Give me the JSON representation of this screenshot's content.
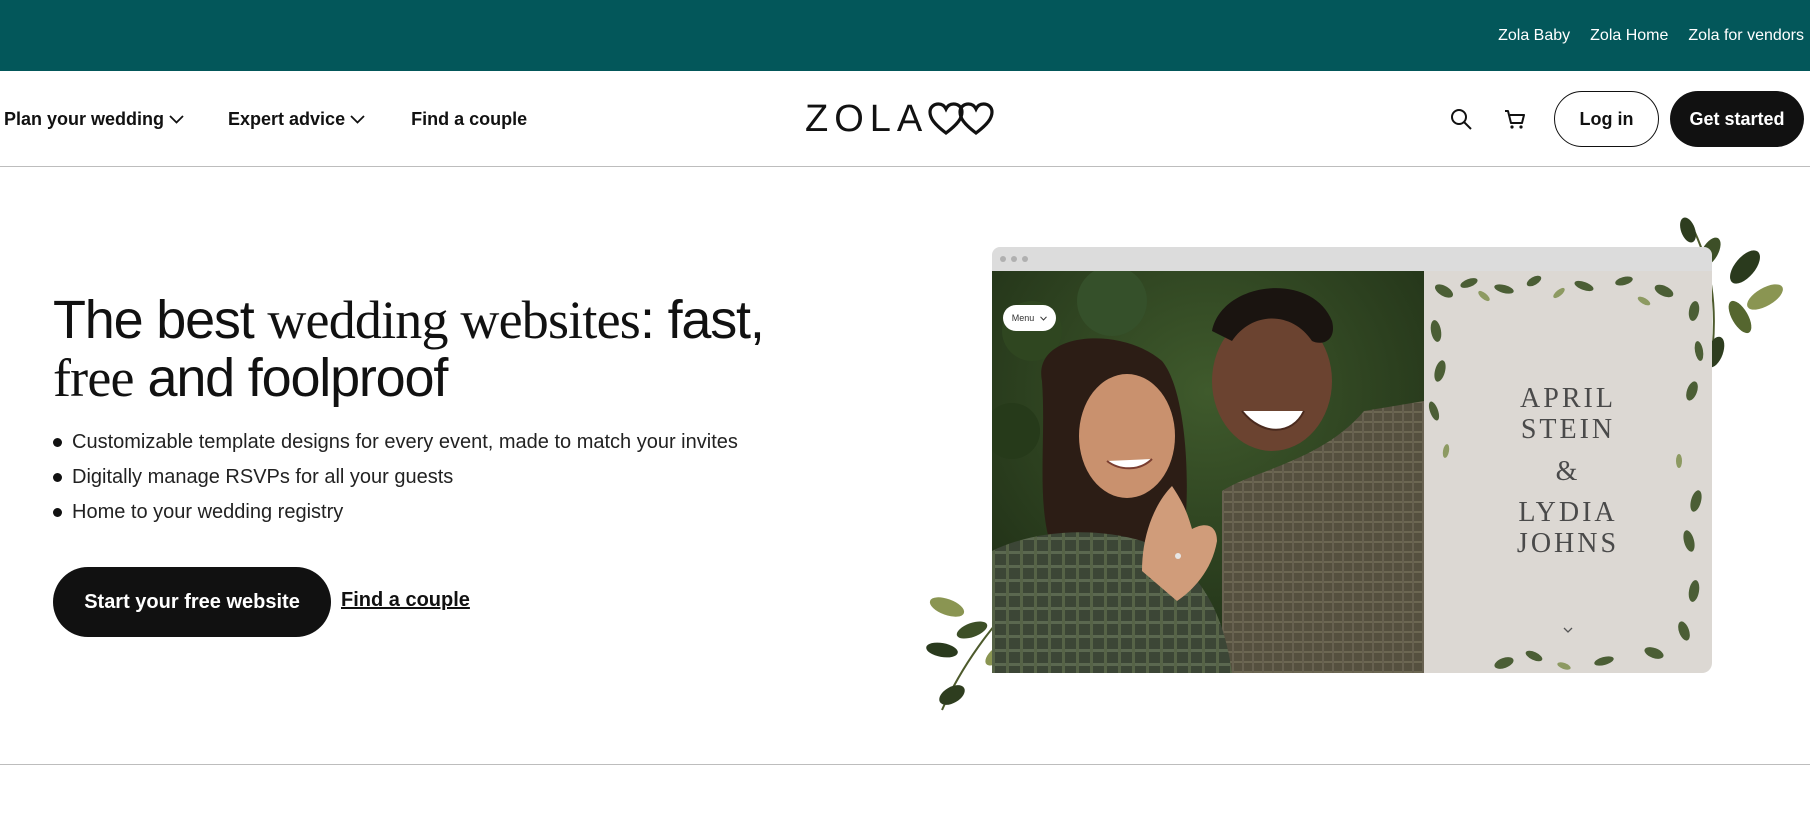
{
  "utility_bar": {
    "links": [
      "Zola Baby",
      "Zola Home",
      "Zola for vendors"
    ],
    "background": "#03575a"
  },
  "nav": {
    "plan_label": "Plan your wedding",
    "advice_label": "Expert advice",
    "find_label": "Find a couple",
    "logo_text": "ZOLA",
    "login_label": "Log in",
    "get_started_label": "Get started",
    "icons": [
      "chevron-down-icon",
      "search-icon",
      "cart-icon",
      "hearts-logo-icon"
    ]
  },
  "hero": {
    "title_part1": "The best ",
    "title_serif": "wedding websites",
    "title_part2": ": fast,",
    "title_serif2": "free",
    "title_part3": " and foolproof",
    "bullets": [
      "Customizable template designs for every event, made to match your invites",
      "Digitally manage RSVPs for all your guests",
      "Home to your wedding registry"
    ],
    "cta_primary": "Start your free website",
    "cta_link": "Find a couple"
  },
  "mockup": {
    "menu_label": "Menu",
    "name1_line1": "APRIL",
    "name1_line2": "STEIN",
    "ampersand": "&",
    "name2_line1": "LYDIA",
    "name2_line2": "JOHNS",
    "icons": [
      "chevron-down-icon",
      "leaf-decoration-icon"
    ]
  },
  "colors": {
    "brand_teal": "#03575a",
    "button_dark": "#111111",
    "panel_beige": "#dcd8d3"
  }
}
